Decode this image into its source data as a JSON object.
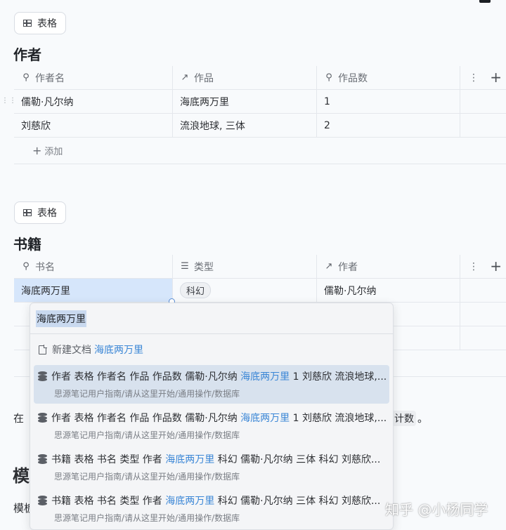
{
  "table1": {
    "view_label": "表格",
    "title": "作者",
    "columns": [
      {
        "icon": "⚲",
        "label": "作者名"
      },
      {
        "icon": "↗",
        "label": "作品"
      },
      {
        "icon": "🔍",
        "label": "作品数"
      }
    ],
    "rows": [
      {
        "name": "儒勒·凡尔纳",
        "works": "海底两万里",
        "count": "1"
      },
      {
        "name": "刘慈欣",
        "works": "流浪地球, 三体",
        "count": "2"
      }
    ],
    "add_label": "添加"
  },
  "table2": {
    "view_label": "表格",
    "title": "书籍",
    "columns": [
      {
        "icon": "⚲",
        "label": "书名"
      },
      {
        "icon": "☰",
        "label": "类型"
      },
      {
        "icon": "↗",
        "label": "作者"
      }
    ],
    "rows": [
      {
        "name": "海底两万里",
        "type": "科幻",
        "author": "儒勒·凡尔纳"
      }
    ]
  },
  "background": {
    "text_zai": "在",
    "code_tail": "计数",
    "period": "。",
    "heading_char": "模",
    "body_char": "模板"
  },
  "popup": {
    "query": "海底两万里",
    "new_doc_prefix": "新建文档",
    "new_doc_name": "海底两万里",
    "items": [
      {
        "before": "作者 表格 作者名 作品 作品数 儒勒·凡尔纳 ",
        "match": "海底两万里",
        "after": " 1 刘慈欣 流浪地球,...",
        "path": "思源笔记用户指南/请从这里开始/通用操作/数据库"
      },
      {
        "before": "作者 表格 作者名 作品 作品数 儒勒·凡尔纳 ",
        "match": "海底两万里",
        "after": " 1 刘慈欣 流浪地球,...",
        "path": "思源笔记用户指南/请从这里开始/通用操作/数据库"
      },
      {
        "before": "书籍 表格 书名 类型 作者 ",
        "match": "海底两万里",
        "after": " 科幻 儒勒·凡尔纳 三体 科幻 刘慈欣...",
        "path": "思源笔记用户指南/请从这里开始/通用操作/数据库"
      },
      {
        "before": "书籍 表格 书名 类型 作者 ",
        "match": "海底两万里",
        "after": " 科幻 儒勒·凡尔纳 三体 科幻 刘慈欣...",
        "path": "思源笔记用户指南/请从这里开始/通用操作/数据库"
      }
    ]
  },
  "watermark": "知乎 @小杨同学",
  "colors": {
    "highlight": "#3a86d6",
    "selected_cell": "#d6e6fb",
    "active_item": "#d8e2ee"
  }
}
